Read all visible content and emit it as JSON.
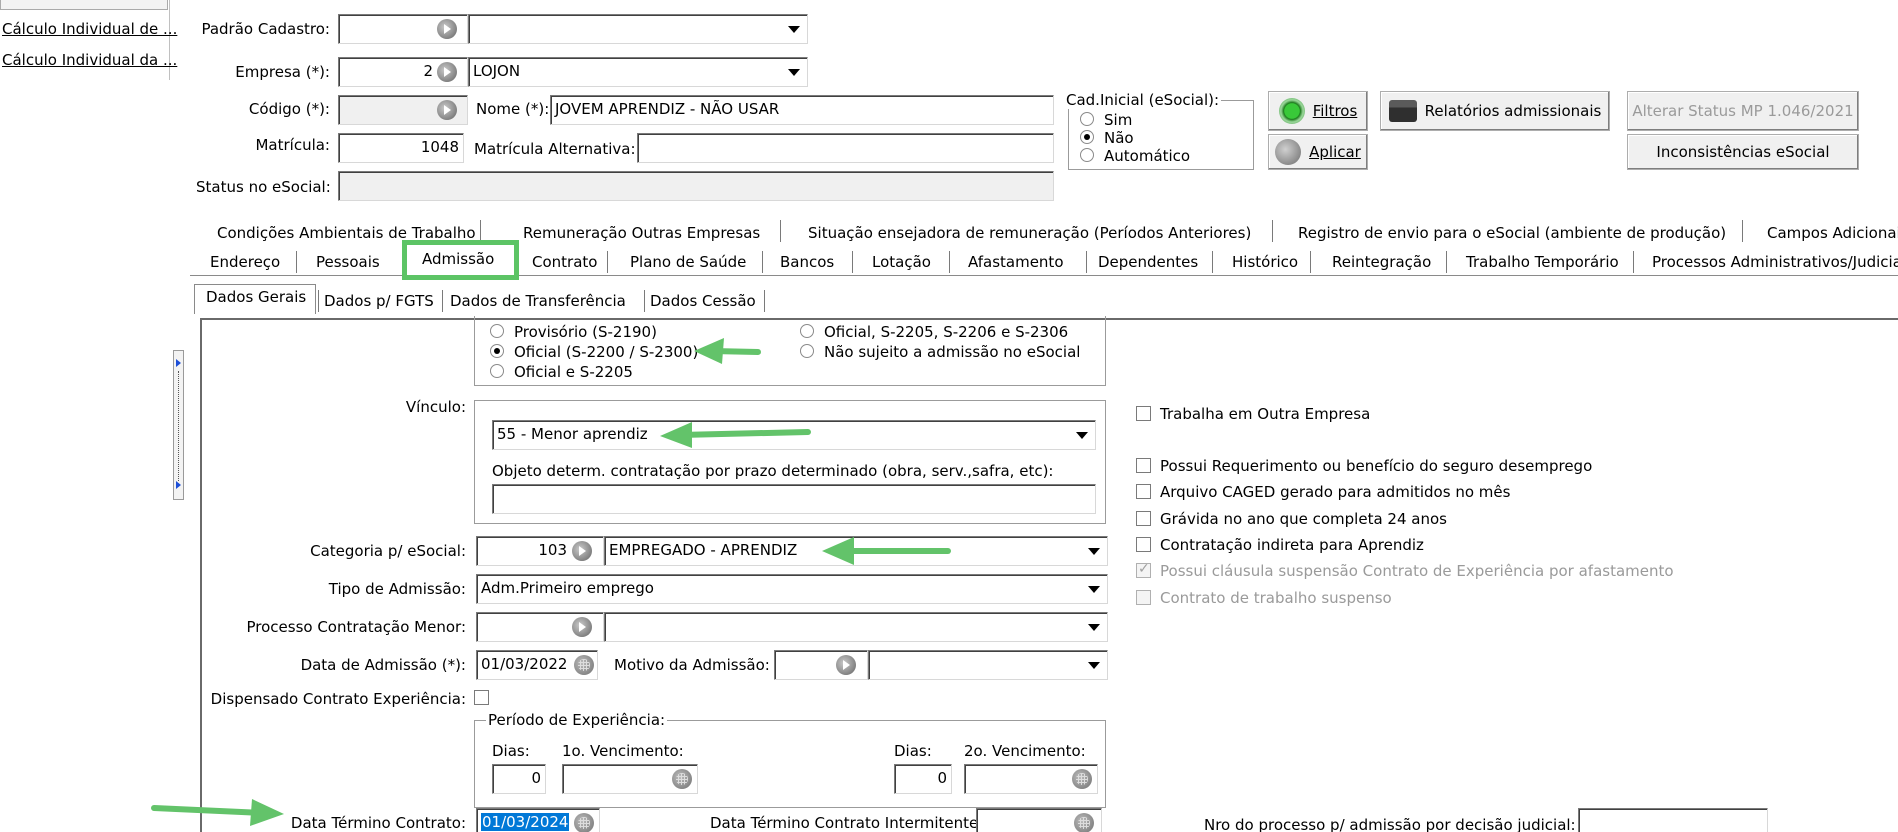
{
  "sidebar": {
    "items": [
      "Cálculo Individual de ...",
      "Cálculo Individual da ..."
    ]
  },
  "header": {
    "padrao_cadastro_label": "Padrão Cadastro:",
    "padrao_cadastro_code": "",
    "padrao_cadastro_value": "",
    "empresa_label": "Empresa (*):",
    "empresa_code": "2",
    "empresa_value": "LOJON",
    "codigo_label": "Código (*):",
    "codigo_value": "",
    "nome_label": "Nome (*):",
    "nome_value": "JOVEM APRENDIZ -  NÃO USAR",
    "matricula_label": "Matrícula:",
    "matricula_value": "1048",
    "matricula_alt_label": "Matrícula Alternativa:",
    "matricula_alt_value": "",
    "status_label": "Status no eSocial:",
    "status_value": ""
  },
  "cad_inicial": {
    "title": "Cad.Inicial (eSocial):",
    "options": [
      "Sim",
      "Não",
      "Automático"
    ],
    "selected": "Não"
  },
  "buttons": {
    "filtros": "Filtros",
    "aplicar": "Aplicar",
    "relatorios": "Relatórios admissionais",
    "alterar_status": "Alterar Status MP 1.046/2021",
    "inconsistencias": "Inconsistências eSocial"
  },
  "tabs_row1": [
    "Condições Ambientais de Trabalho",
    "Remuneração Outras Empresas",
    "Situação ensejadora de remuneração (Períodos Anteriores)",
    "Registro de envio para o eSocial (ambiente de produção)",
    "Campos Adicionais"
  ],
  "tabs_row2": [
    "Endereço",
    "Pessoais",
    "Admissão",
    "Contrato",
    "Plano de Saúde",
    "Bancos",
    "Lotação",
    "Afastamento",
    "Dependentes",
    "Histórico",
    "Reintegração",
    "Trabalho Temporário",
    "Processos Administrativos/Judiciais"
  ],
  "active_tab": "Admissão",
  "subtabs": [
    "Dados Gerais",
    "Dados p/ FGTS",
    "Dados de Transferência",
    "Dados Cessão"
  ],
  "active_subtab": "Dados Gerais",
  "admissao_esocial": {
    "options": [
      "Provisório (S-2190)",
      "Oficial (S-2200 / S-2300)",
      "Oficial e S-2205",
      "Oficial, S-2205, S-2206 e S-2306",
      "Não sujeito a admissão no eSocial"
    ],
    "selected": "Oficial (S-2200 / S-2300)"
  },
  "form": {
    "vinculo_label": "Vínculo:",
    "vinculo_value": "55 - Menor aprendiz",
    "objeto_label": "Objeto determ. contratação por prazo determinado (obra, serv.,safra, etc):",
    "objeto_value": "",
    "categoria_label": "Categoria p/ eSocial:",
    "categoria_code": "103",
    "categoria_value": "EMPREGADO - APRENDIZ",
    "tipo_admissao_label": "Tipo de Admissão:",
    "tipo_admissao_value": "Adm.Primeiro emprego",
    "processo_menor_label": "Processo Contratação Menor:",
    "processo_menor_code": "",
    "processo_menor_value": "",
    "data_admissao_label": "Data de Admissão (*):",
    "data_admissao_value": "01/03/2022",
    "motivo_label": "Motivo da Admissão:",
    "motivo_code": "",
    "motivo_value": "",
    "dispensado_label": "Dispensado Contrato Experiência:",
    "periodo_title": "Período de Experiência:",
    "dias1_label": "Dias:",
    "dias1_value": "0",
    "venc1_label": "1o. Vencimento:",
    "venc1_value": "",
    "dias2_label": "Dias:",
    "dias2_value": "0",
    "venc2_label": "2o. Vencimento:",
    "venc2_value": "",
    "termino_label": "Data Término Contrato:",
    "termino_value": "01/03/2024",
    "termino_intermitente_label": "Data Término Contrato Intermitente:",
    "termino_intermitente_value": "",
    "nro_processo_label": "Nro do processo p/ admissão por decisão judicial:",
    "nro_processo_value": ""
  },
  "checkboxes": [
    {
      "label": "Trabalha em Outra Empresa",
      "checked": false,
      "disabled": false
    },
    {
      "label": "Possui Requerimento ou benefício do seguro desemprego",
      "checked": false,
      "disabled": false
    },
    {
      "label": "Arquivo CAGED gerado para admitidos no mês",
      "checked": false,
      "disabled": false
    },
    {
      "label": "Grávida no ano que completa 24 anos",
      "checked": false,
      "disabled": false
    },
    {
      "label": "Contratação indireta para Aprendiz",
      "checked": false,
      "disabled": false
    },
    {
      "label": "Possui cláusula suspensão Contrato de Experiência por afastamento",
      "checked": true,
      "disabled": true
    },
    {
      "label": "Contrato de trabalho suspenso",
      "checked": false,
      "disabled": true
    }
  ],
  "colors": {
    "highlight": "#5cc465",
    "arrow": "#63c36a",
    "selection": "#0078d7"
  }
}
